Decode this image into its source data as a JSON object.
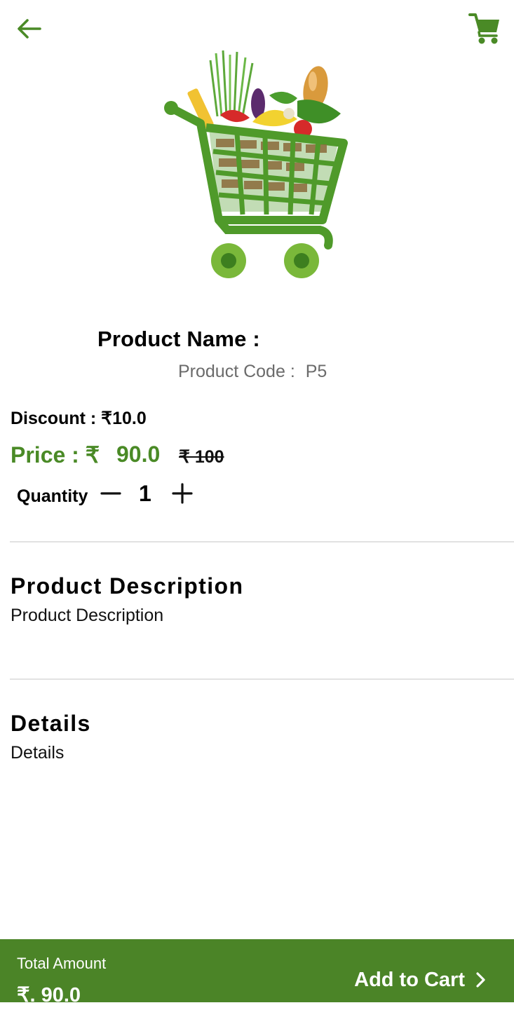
{
  "colors": {
    "accent": "#4a8a26",
    "bottom_bar": "#4b8427",
    "text_muted": "#6b6b6b",
    "divider": "#e2e2e2"
  },
  "icons": {
    "back": "arrow-left-icon",
    "cart": "shopping-cart-icon",
    "minus": "minus-icon",
    "plus": "plus-icon",
    "chevron": "chevron-right-icon"
  },
  "product": {
    "name_label": "Product Name :",
    "name_value": "",
    "code_label": "Product Code :",
    "code_value": "P5",
    "discount_text": "Discount : ₹10.0",
    "price_label": "Price : ₹",
    "price_value": "90.0",
    "mrp_text": "₹ 100"
  },
  "quantity": {
    "label": "Quantity",
    "value": "1"
  },
  "sections": {
    "description_heading": "Product Description",
    "description_text": "Product Description",
    "details_heading": "Details",
    "details_text": "Details"
  },
  "footer": {
    "total_label": "Total Amount",
    "total_value": "₹. 90.0",
    "add_to_cart_label": "Add to Cart"
  }
}
